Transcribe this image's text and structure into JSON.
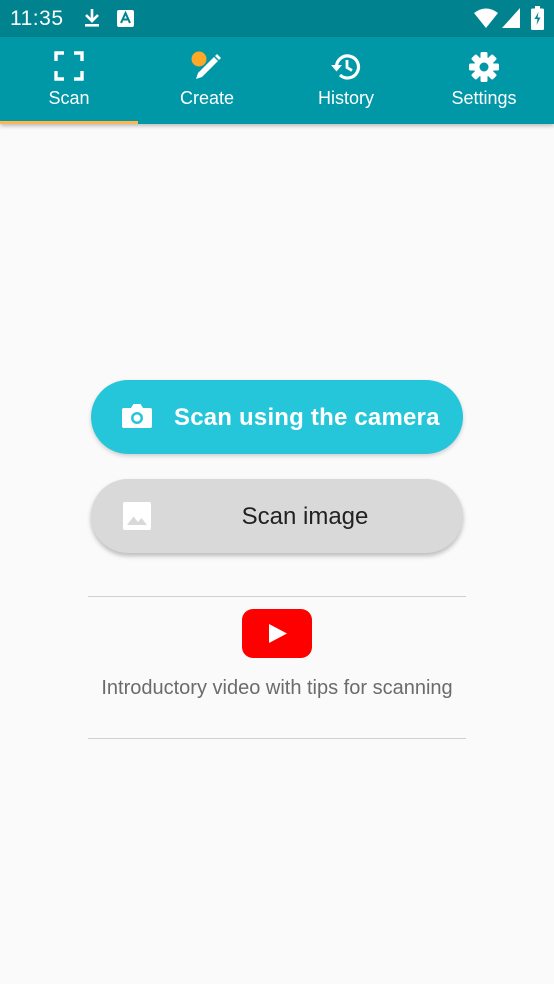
{
  "status_bar": {
    "time": "11:35",
    "icons": [
      "download-icon",
      "app-notification-icon",
      "wifi-icon",
      "signal-icon",
      "battery-icon"
    ]
  },
  "tabs": [
    {
      "label": "Scan",
      "icon": "scan-frame-icon",
      "selected": true
    },
    {
      "label": "Create",
      "icon": "pencil-icon",
      "selected": false
    },
    {
      "label": "History",
      "icon": "history-icon",
      "selected": false
    },
    {
      "label": "Settings",
      "icon": "gear-icon",
      "selected": false
    }
  ],
  "actions": {
    "camera_label": "Scan using the camera",
    "image_label": "Scan image"
  },
  "video": {
    "text": "Introductory video with tips for scanning"
  },
  "colors": {
    "status_bar": "#00838f",
    "toolbar": "#0097a7",
    "tab_indicator": "#ffb74d",
    "camera_button": "#26c6da",
    "image_button": "#d9d9d9",
    "youtube_red": "#ff0000"
  }
}
